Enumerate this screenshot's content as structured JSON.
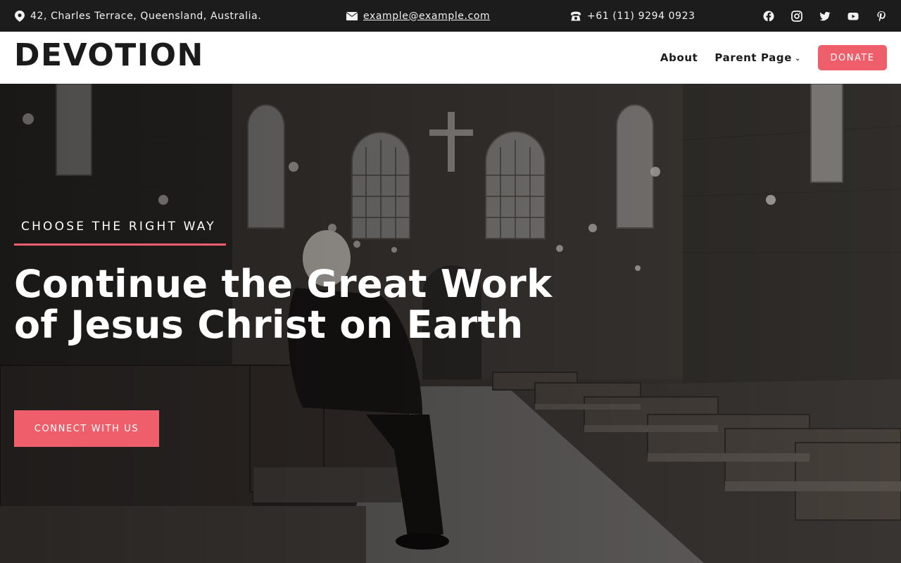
{
  "topbar": {
    "address": "42, Charles Terrace, Queensland, Australia.",
    "email": "example@example.com",
    "phone": "+61 (11) 9294 0923",
    "social": [
      "facebook-icon",
      "instagram-icon",
      "twitter-icon",
      "youtube-icon",
      "pinterest-icon"
    ]
  },
  "header": {
    "logo": "DEVOTION",
    "nav": {
      "about": "About",
      "parent_page": "Parent Page",
      "donate": "DONATE"
    }
  },
  "hero": {
    "eyebrow": "CHOOSE THE RIGHT WAY",
    "headline": "Continue the Great Work of Jesus Christ on Earth",
    "cta": "CONNECT WITH US",
    "background": "church-interior-photo"
  },
  "colors": {
    "accent": "#ee5f6b",
    "topbar_bg": "#1c1c1c",
    "header_bg": "#ffffff",
    "logo_text": "#1b1b1b"
  }
}
